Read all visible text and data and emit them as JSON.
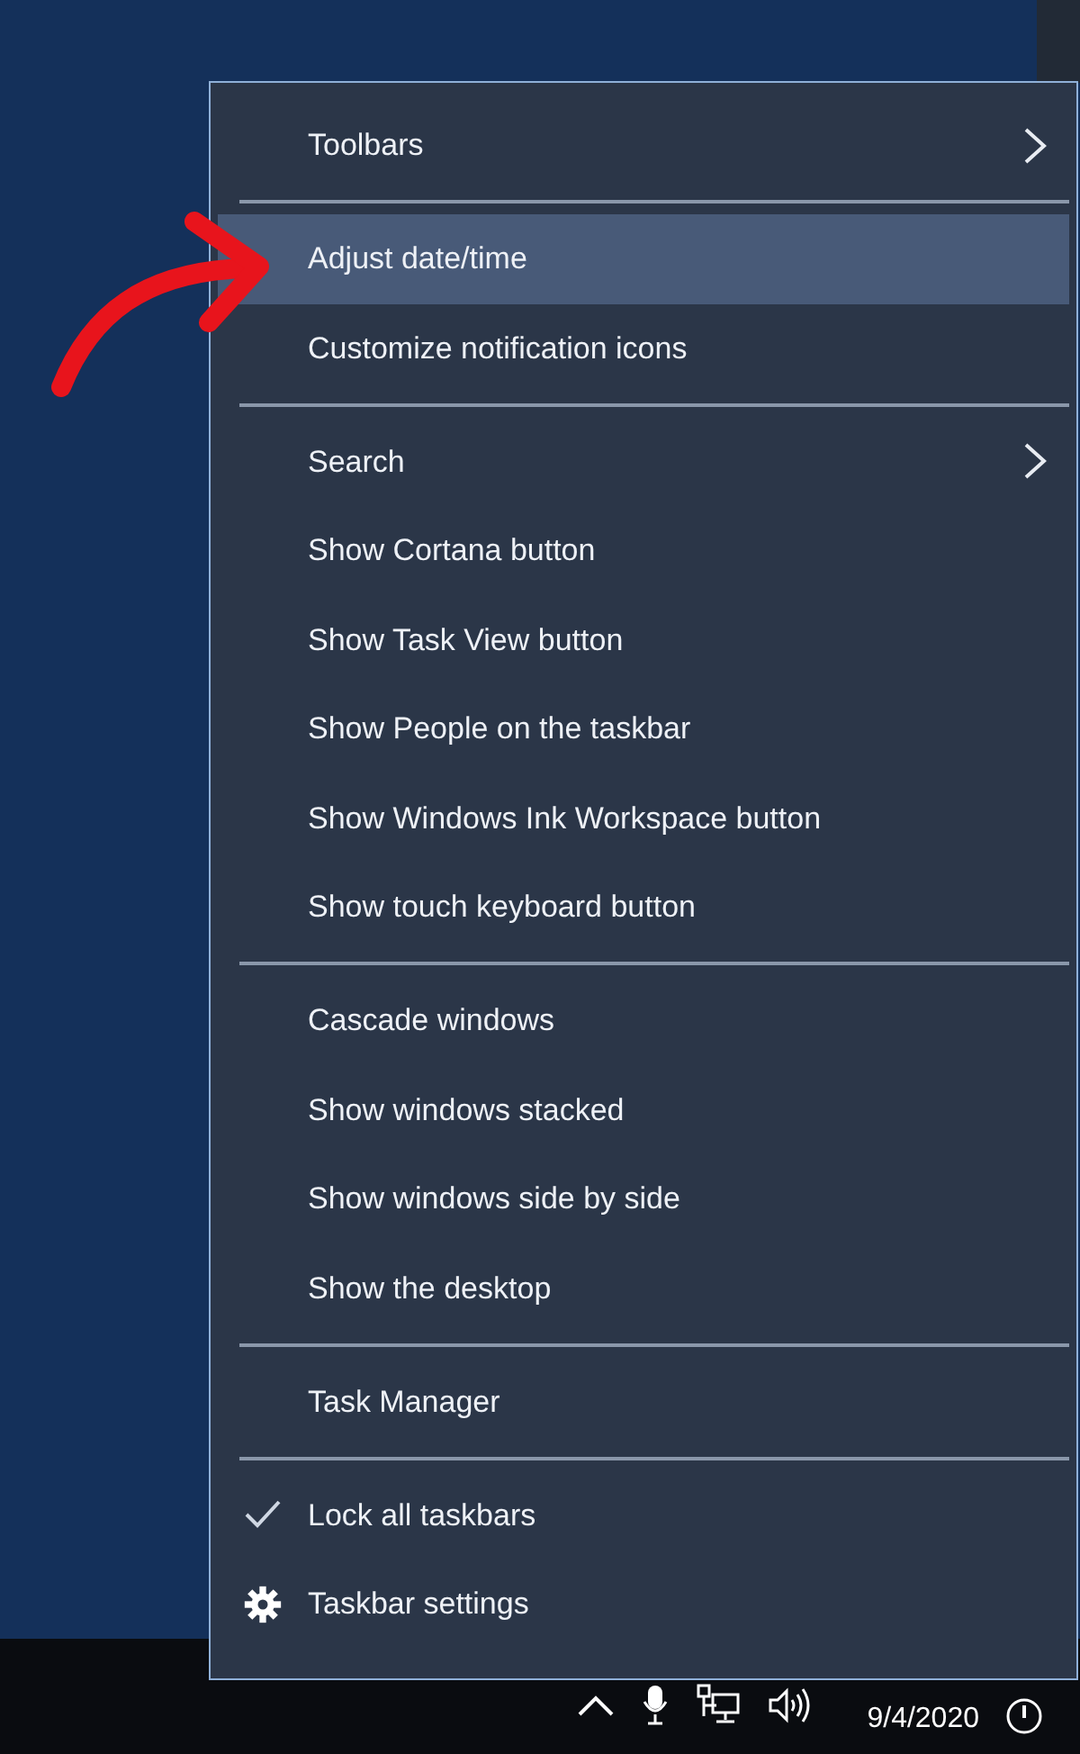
{
  "context_menu": {
    "groups": [
      [
        {
          "label": "Toolbars",
          "kind": "submenu",
          "selected": false
        }
      ],
      [
        {
          "label": "Adjust date/time",
          "kind": "plain",
          "selected": true
        },
        {
          "label": "Customize notification icons",
          "kind": "plain",
          "selected": false
        }
      ],
      [
        {
          "label": "Search",
          "kind": "submenu",
          "selected": false
        },
        {
          "label": "Show Cortana button",
          "kind": "plain",
          "selected": false
        },
        {
          "label": "Show Task View button",
          "kind": "plain",
          "selected": false
        },
        {
          "label": "Show People on the taskbar",
          "kind": "plain",
          "selected": false
        },
        {
          "label": "Show Windows Ink Workspace button",
          "kind": "plain",
          "selected": false
        },
        {
          "label": "Show touch keyboard button",
          "kind": "plain",
          "selected": false
        }
      ],
      [
        {
          "label": "Cascade windows",
          "kind": "plain",
          "selected": false
        },
        {
          "label": "Show windows stacked",
          "kind": "plain",
          "selected": false
        },
        {
          "label": "Show windows side by side",
          "kind": "plain",
          "selected": false
        },
        {
          "label": "Show the desktop",
          "kind": "plain",
          "selected": false
        }
      ],
      [
        {
          "label": "Task Manager",
          "kind": "plain",
          "selected": false
        }
      ],
      [
        {
          "label": "Lock all taskbars",
          "kind": "check",
          "checked": true,
          "selected": false
        },
        {
          "label": "Taskbar settings",
          "kind": "settings",
          "selected": false
        }
      ]
    ]
  },
  "taskbar": {
    "date": "9/4/2020"
  }
}
